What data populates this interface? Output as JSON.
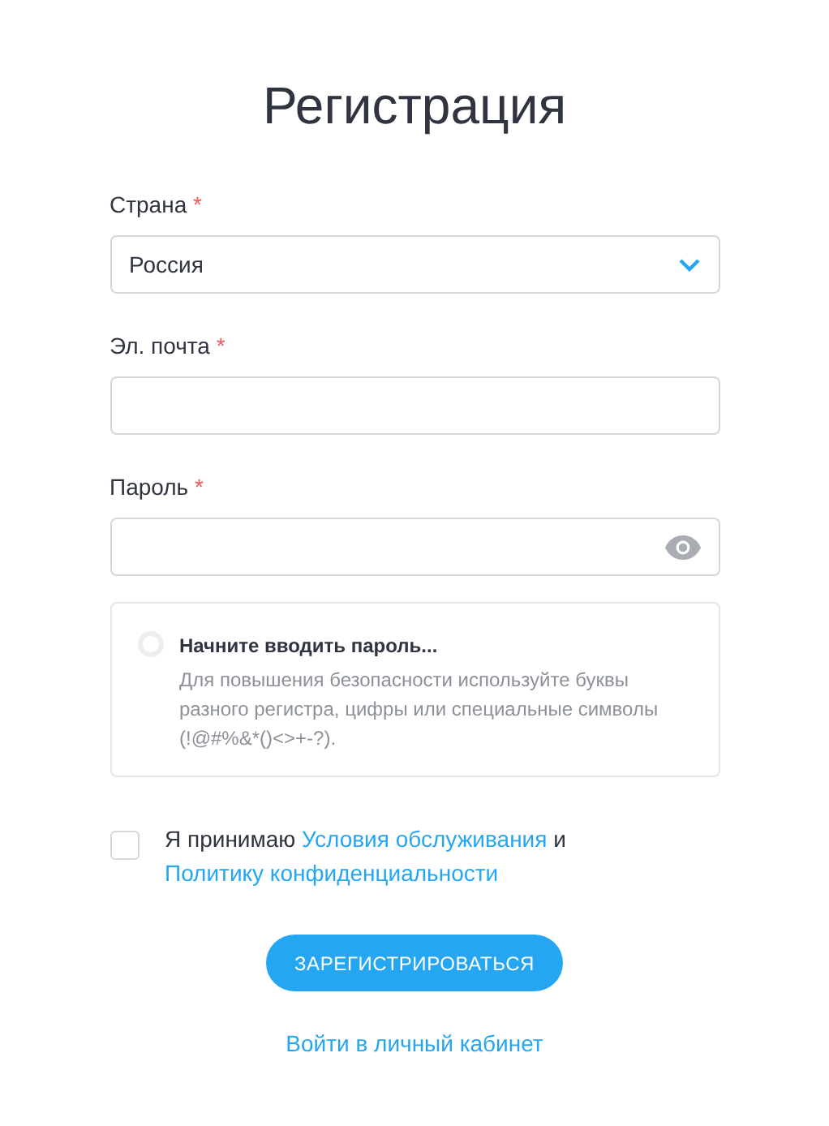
{
  "title": "Регистрация",
  "fields": [
    {
      "kind": "select",
      "label": "Страна",
      "required_mark": "*",
      "value": "Россия"
    },
    {
      "kind": "text",
      "label": "Эл. почта",
      "required_mark": "*"
    },
    {
      "kind": "password",
      "label": "Пароль",
      "required_mark": "*"
    }
  ],
  "password_hint": {
    "heading": "Начните вводить пароль...",
    "text": "Для повышения безопасности используйте буквы разного регистра, цифры или специальные символы (!@#%&*()<>+-?)."
  },
  "consent": {
    "checked": false,
    "parts": [
      {
        "kind": "text",
        "text": "Я принимаю"
      },
      {
        "kind": "link",
        "text": "Условия обслуживания"
      },
      {
        "kind": "text",
        "text": "и"
      },
      {
        "kind": "link",
        "text": "Политику конфиденциальности"
      }
    ]
  },
  "submit_button": "ЗАРЕГИСТРИРОВАТЬСЯ",
  "login_link": "Войти в личный кабинет"
}
